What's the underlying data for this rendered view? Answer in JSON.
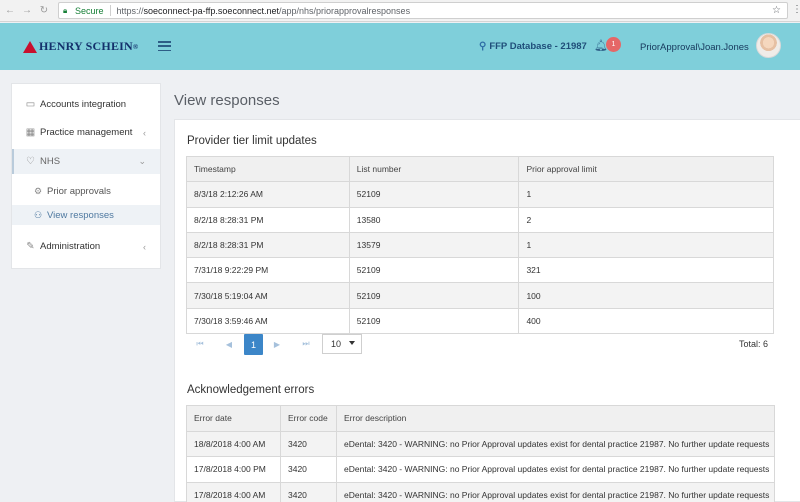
{
  "browser": {
    "secure_label": "Secure",
    "url_scheme": "https://",
    "url_host": "soeconnect-pa-ffp.soeconnect.net",
    "url_path": "/app/nhs/priorapprovalresponses"
  },
  "header": {
    "brand": "HENRY SCHEIN",
    "brand_mark": "®",
    "database": "FFP Database - 21987",
    "notification_count": "1",
    "user": "PriorApproval\\Joan.Jones"
  },
  "sidebar": {
    "items": [
      {
        "label": "Accounts integration",
        "icon": "briefcase-icon"
      },
      {
        "label": "Practice management",
        "icon": "grid-icon"
      },
      {
        "label": "NHS",
        "icon": "heart-icon"
      },
      {
        "label": "Administration",
        "icon": "wrench-icon"
      }
    ],
    "subitems": [
      {
        "label": "Prior approvals",
        "icon": "gear-icon"
      },
      {
        "label": "View responses",
        "icon": "users-icon"
      }
    ]
  },
  "page": {
    "title": "View responses"
  },
  "provider_tier": {
    "title": "Provider tier limit updates",
    "columns": [
      "Timestamp",
      "List number",
      "Prior approval limit"
    ],
    "rows": [
      [
        "8/3/18 2:12:26 AM",
        "52109",
        "1"
      ],
      [
        "8/2/18 8:28:31 PM",
        "13580",
        "2"
      ],
      [
        "8/2/18 8:28:31 PM",
        "13579",
        "1"
      ],
      [
        "7/31/18 9:22:29 PM",
        "52109",
        "321"
      ],
      [
        "7/30/18 5:19:04 AM",
        "52109",
        "100"
      ],
      [
        "7/30/18 3:59:46 AM",
        "52109",
        "400"
      ]
    ],
    "pager": {
      "current_page": "1",
      "page_size": "10",
      "total": "Total: 6"
    }
  },
  "ack_errors": {
    "title": "Acknowledgement errors",
    "columns": [
      "Error date",
      "Error code",
      "Error description"
    ],
    "rows": [
      [
        "18/8/2018 4:00 AM",
        "3420",
        "eDental: 3420 - WARNING: no Prior Approval updates exist for dental practice 21987. No further update requests"
      ],
      [
        "17/8/2018 4:00 PM",
        "3420",
        "eDental: 3420 - WARNING: no Prior Approval updates exist for dental practice 21987. No further update requests"
      ],
      [
        "17/8/2018 4:00 AM",
        "3420",
        "eDental: 3420 - WARNING: no Prior Approval updates exist for dental practice 21987. No further update requests"
      ]
    ]
  }
}
